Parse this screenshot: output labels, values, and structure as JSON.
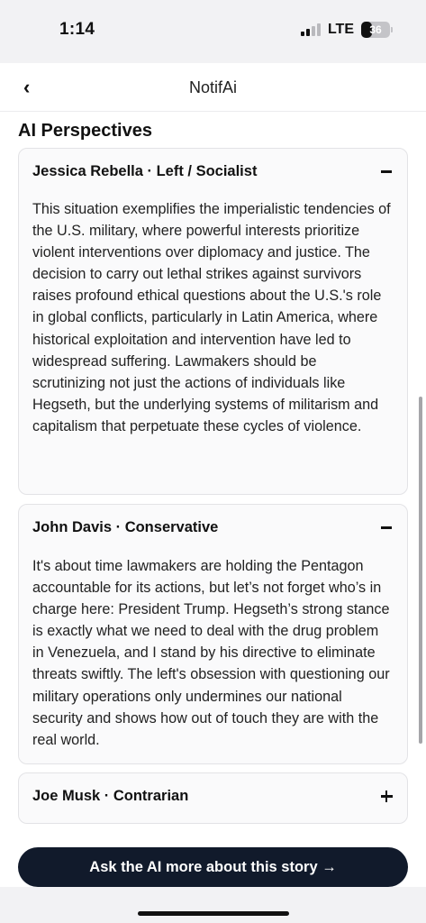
{
  "status_bar": {
    "time": "1:14",
    "network": "LTE",
    "battery_level": "36"
  },
  "nav": {
    "back_icon": "chevron-left-icon",
    "back_glyph": "‹",
    "title": "NotifAi"
  },
  "section": {
    "title": "AI Perspectives"
  },
  "perspectives": [
    {
      "name": "Jessica Rebella · Left / Socialist",
      "expanded": true,
      "text": "This situation exemplifies the imperialistic tendencies of the U.S. military, where powerful interests prioritize violent interventions over diplomacy and justice. The decision to carry out lethal strikes against survivors raises profound ethical questions about the U.S.'s role in global conflicts, particularly in Latin America, where historical exploitation and intervention have led to widespread suffering. Lawmakers should be scrutinizing not just the actions of individuals like Hegseth, but the underlying systems of militarism and capitalism that perpetuate these cycles of violence."
    },
    {
      "name": "John Davis · Conservative",
      "expanded": true,
      "text": "It's about time lawmakers are holding the Pentagon accountable for its actions, but let’s not forget who’s in charge here: President Trump. Hegseth’s strong stance is exactly what we need to deal with the drug problem in Venezuela, and I stand by his directive to eliminate threats swiftly. The left's obsession with questioning our military operations only undermines our national security and shows how out of touch they are with the real world."
    },
    {
      "name": "Joe Musk · Contrarian",
      "expanded": false,
      "text": ""
    }
  ],
  "ask_button": {
    "label": "Ask the AI more about this story →"
  }
}
